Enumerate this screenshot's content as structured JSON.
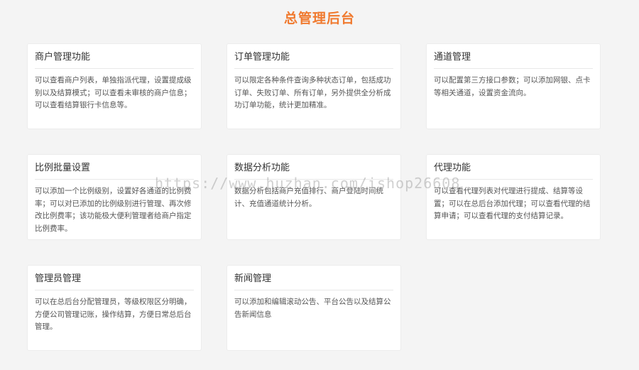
{
  "header": {
    "title": "总管理后台"
  },
  "cards": [
    {
      "title": "商户管理功能",
      "desc": "可以查看商户列表，单独指派代理，设置提成级别以及结算模式；可以查看未审核的商户信息；可以查看结算银行卡信息等。"
    },
    {
      "title": "订单管理功能",
      "desc": "可以限定各种条件查询多种状态订单，包括成功订单、失败订单、所有订单，另外提供全分析成功订单功能，统计更加精准。"
    },
    {
      "title": "通道管理",
      "desc": "可以配置第三方接口参数；可以添加网银、点卡等相关通道，设置资金流向。"
    },
    {
      "title": "比例批量设置",
      "desc": "可以添加一个比例级别，设置好各通道的比例费率；可以对已添加的比例级别进行管理、再次修改比例费率；该功能极大便利管理者给商户指定比例费率。"
    },
    {
      "title": "数据分析功能",
      "desc": "数据分析包括商户充值排行、商户登陆时间统计、充值通道统计分析。"
    },
    {
      "title": "代理功能",
      "desc": "可以查看代理列表对代理进行提成、结算等设置；可以在总后台添加代理；可以查看代理的结算申请；可以查看代理的支付结算记录。"
    },
    {
      "title": "管理员管理",
      "desc": "可以在总后台分配管理员，等级权限区分明确，方便公司管理记账，操作结算，方便日常总后台管理。"
    },
    {
      "title": "新闻管理",
      "desc": "可以添加和编辑滚动公告、平台公告以及结算公告新闻信息"
    }
  ],
  "watermark": {
    "text": "https://www.huzhan.com/ishop26608"
  }
}
